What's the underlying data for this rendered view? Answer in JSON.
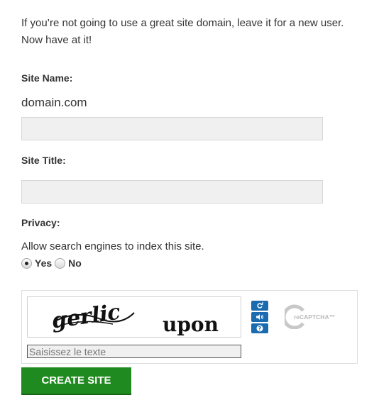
{
  "intro": {
    "line1": "If you’re not going to use a great site domain, leave it for a new user.",
    "line2": "Now have at it!"
  },
  "site_name": {
    "label": "Site Name:",
    "domain_suffix": "domain.com",
    "value": ""
  },
  "site_title": {
    "label": "Site Title:",
    "value": ""
  },
  "privacy": {
    "label": "Privacy:",
    "hint": "Allow search engines to index this site.",
    "options": [
      {
        "label": "Yes",
        "checked": true
      },
      {
        "label": "No",
        "checked": false
      }
    ]
  },
  "captcha": {
    "distorted_word": "gerlic",
    "word": "upon",
    "input_placeholder": "Saisissez le texte",
    "logo_text": "reCAPTCHA™",
    "buttons": [
      "refresh-icon",
      "audio-icon",
      "help-icon"
    ],
    "accent_color": "#1a6bb0"
  },
  "submit": {
    "label": "CREATE SITE",
    "color": "#1f8a1f"
  }
}
